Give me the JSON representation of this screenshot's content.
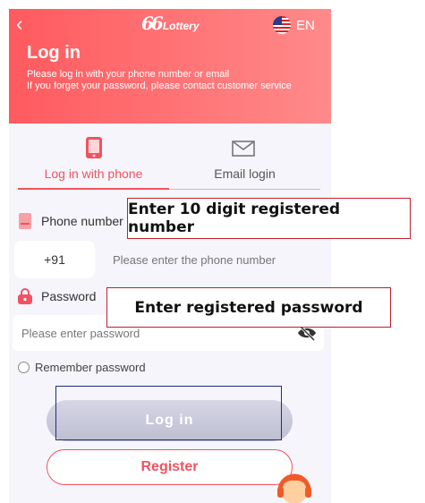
{
  "header": {
    "back_icon": "chevron-left-icon",
    "logo_mark": "66",
    "logo_text": "Lottery",
    "language": {
      "flag_icon": "us-flag-icon",
      "label": "EN"
    },
    "title": "Log in",
    "subtitle_line1": "Please log in with your phone number or email",
    "subtitle_line2": "If you forget your password, please contact customer service",
    "gradient": [
      "#ff5a5f",
      "#ff8a8a"
    ]
  },
  "tabs": [
    {
      "label": "Log in with phone",
      "icon": "phone-icon",
      "active": true
    },
    {
      "label": "Email login",
      "icon": "mail-icon",
      "active": false
    }
  ],
  "phone": {
    "label": "Phone number",
    "country_code": "+91",
    "placeholder": "Please enter the phone number"
  },
  "password": {
    "label": "Password",
    "placeholder": "Please enter password",
    "visibility_icon": "eye-off-icon"
  },
  "remember_label": "Remember password",
  "buttons": {
    "login": "Log in",
    "register": "Register"
  },
  "support_icon": "customer-service-icon",
  "annotations": {
    "phone": "Enter 10 digit registered number",
    "password": "Enter registered password"
  },
  "colors": {
    "accent": "#f0535f",
    "annotation_border": "#c0202a",
    "focus_border": "#1f2e78"
  }
}
